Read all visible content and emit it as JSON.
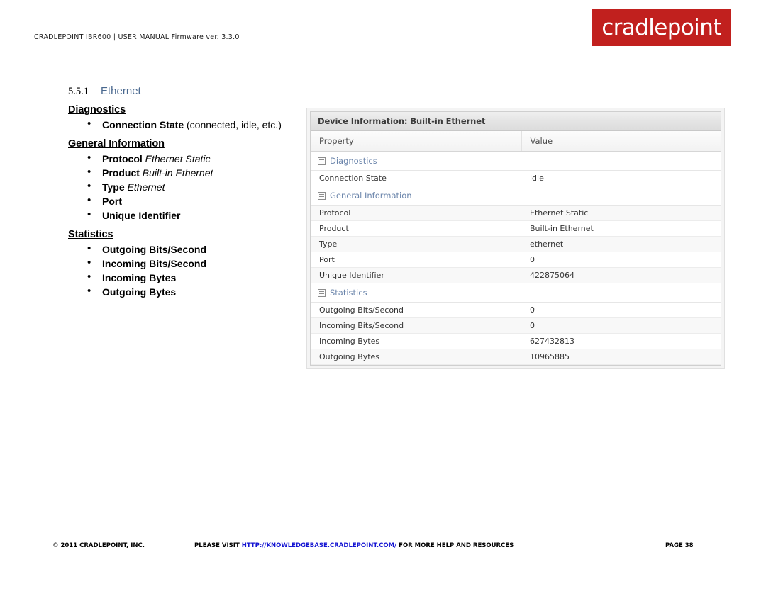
{
  "header": {
    "meta": "CRADLEPOINT IBR600 | USER MANUAL Firmware ver. 3.3.0",
    "logo_text": "cradlepoint",
    "logo_bg": "#c1201e"
  },
  "section": {
    "number": "5.5.1",
    "title": "Ethernet",
    "title_color": "#49688f"
  },
  "groups": [
    {
      "heading": "Diagnostics",
      "items": [
        {
          "term": "Connection State",
          "desc": " (connected, idle, etc.)",
          "style": "plain"
        }
      ]
    },
    {
      "heading": "General Information",
      "items": [
        {
          "term": "Protocol",
          "desc": " Ethernet Static",
          "style": "italic"
        },
        {
          "term": "Product",
          "desc": " Built-in Ethernet",
          "style": "italic"
        },
        {
          "term": "Type",
          "desc": " Ethernet",
          "style": "italic"
        },
        {
          "term": "Port",
          "desc": "",
          "style": "italic"
        },
        {
          "term": "Unique Identifier",
          "desc": "",
          "style": "italic"
        }
      ]
    },
    {
      "heading": "Statistics",
      "items": [
        {
          "term": "Outgoing Bits/Second",
          "desc": "",
          "style": "italic"
        },
        {
          "term": "Incoming Bits/Second",
          "desc": "",
          "style": "italic"
        },
        {
          "term": "Incoming Bytes",
          "desc": "",
          "style": "italic"
        },
        {
          "term": "Outgoing Bytes",
          "desc": "",
          "style": "italic"
        }
      ]
    }
  ],
  "panel": {
    "title": "Device Information: Built-in Ethernet",
    "columns": [
      "Property",
      "Value"
    ],
    "collapse_icon": "collapse-tree-icon",
    "rows": [
      {
        "kind": "group",
        "property": "Diagnostics",
        "value": ""
      },
      {
        "kind": "data",
        "property": "Connection State",
        "value": "idle"
      },
      {
        "kind": "group",
        "property": "General Information",
        "value": ""
      },
      {
        "kind": "data",
        "property": "Protocol",
        "value": "Ethernet Static"
      },
      {
        "kind": "data",
        "property": "Product",
        "value": "Built-in Ethernet"
      },
      {
        "kind": "data",
        "property": "Type",
        "value": "ethernet"
      },
      {
        "kind": "data",
        "property": "Port",
        "value": "0"
      },
      {
        "kind": "data",
        "property": "Unique Identifier",
        "value": "422875064"
      },
      {
        "kind": "group",
        "property": "Statistics",
        "value": ""
      },
      {
        "kind": "data",
        "property": "Outgoing Bits/Second",
        "value": "0"
      },
      {
        "kind": "data",
        "property": "Incoming Bits/Second",
        "value": "0"
      },
      {
        "kind": "data",
        "property": "Incoming Bytes",
        "value": "627432813"
      },
      {
        "kind": "data",
        "property": "Outgoing Bytes",
        "value": "10965885"
      }
    ]
  },
  "footer": {
    "copyright_symbol": "©",
    "copyright": "2011 CRADLEPOINT, INC.",
    "visit_prefix": "PLEASE VISIT ",
    "link": "HTTP://KNOWLEDGEBASE.CRADLEPOINT.COM/",
    "visit_suffix": " FOR MORE HELP AND RESOURCES",
    "page": "PAGE 38"
  }
}
